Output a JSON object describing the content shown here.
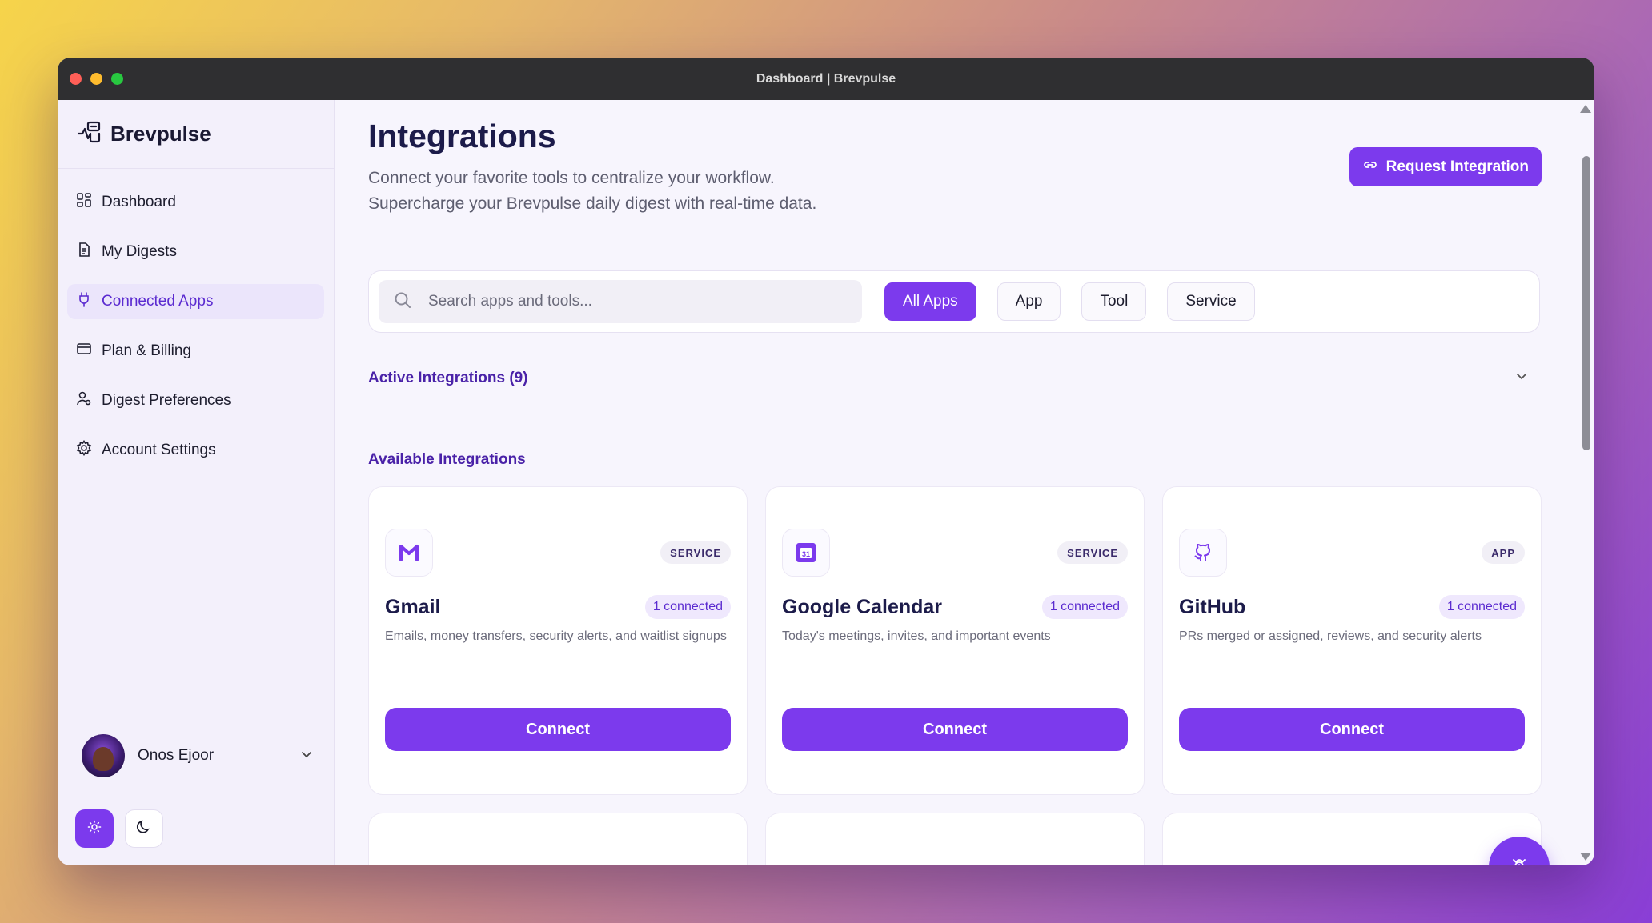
{
  "window": {
    "title": "Dashboard | Brevpulse"
  },
  "brand": {
    "name": "Brevpulse",
    "icon": "brevpulse-logo-icon"
  },
  "sidebar": {
    "items": [
      {
        "label": "Dashboard",
        "icon": "grid-icon",
        "active": false
      },
      {
        "label": "My Digests",
        "icon": "document-icon",
        "active": false
      },
      {
        "label": "Connected Apps",
        "icon": "plug-icon",
        "active": true
      },
      {
        "label": "Plan & Billing",
        "icon": "credit-card-icon",
        "active": false
      },
      {
        "label": "Digest Preferences",
        "icon": "user-settings-icon",
        "active": false
      },
      {
        "label": "Account Settings",
        "icon": "gear-icon",
        "active": false
      }
    ],
    "user": {
      "name": "Onos Ejoor"
    }
  },
  "main": {
    "title": "Integrations",
    "subtitle_line1": "Connect your favorite tools to centralize your workflow.",
    "subtitle_line2": "Supercharge your Brevpulse daily digest with real-time data.",
    "request_button": "Request Integration",
    "search": {
      "placeholder": "Search apps and tools..."
    },
    "filters": [
      "All Apps",
      "App",
      "Tool",
      "Service"
    ],
    "active_filter": "All Apps",
    "active_section": "Active Integrations (9)",
    "available_section": "Available Integrations",
    "cards": [
      {
        "name": "Gmail",
        "type": "SERVICE",
        "status": "1 connected",
        "description": "Emails, money transfers, security alerts, and waitlist signups",
        "button": "Connect",
        "icon": "gmail-icon"
      },
      {
        "name": "Google Calendar",
        "type": "SERVICE",
        "status": "1 connected",
        "description": "Today's meetings, invites, and important events",
        "button": "Connect",
        "icon": "calendar-icon"
      },
      {
        "name": "GitHub",
        "type": "APP",
        "status": "1 connected",
        "description": "PRs merged or assigned, reviews, and security alerts",
        "button": "Connect",
        "icon": "github-icon"
      }
    ]
  },
  "colors": {
    "accent": "#7c3aed",
    "heading": "#1c1b4a",
    "section": "#4a22a8"
  }
}
